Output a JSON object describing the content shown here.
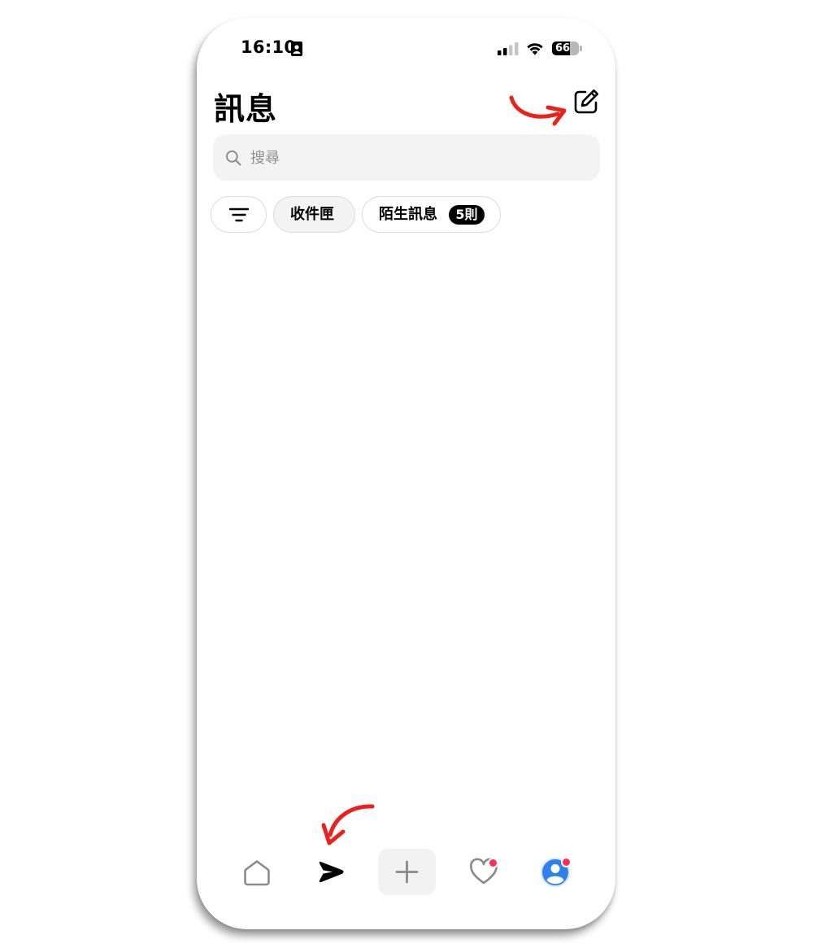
{
  "status_bar": {
    "time": "16:10",
    "battery_level": 66,
    "battery_text": "66"
  },
  "header": {
    "title": "訊息"
  },
  "search": {
    "placeholder": "搜尋"
  },
  "filters": {
    "inbox_label": "收件匣",
    "requests_label": "陌生訊息",
    "requests_badge": "5則"
  },
  "colors": {
    "accent_blue": "#2f80ed",
    "notification_red": "#ff2d55",
    "annotation_red": "#e8221c"
  },
  "icons": {
    "compose": "pencil-square-icon",
    "search": "magnifier-icon",
    "filter": "filter-lines-icon",
    "home": "home-icon",
    "messages": "send-icon",
    "create": "plus-icon",
    "activity": "heart-icon",
    "profile": "avatar-icon"
  }
}
